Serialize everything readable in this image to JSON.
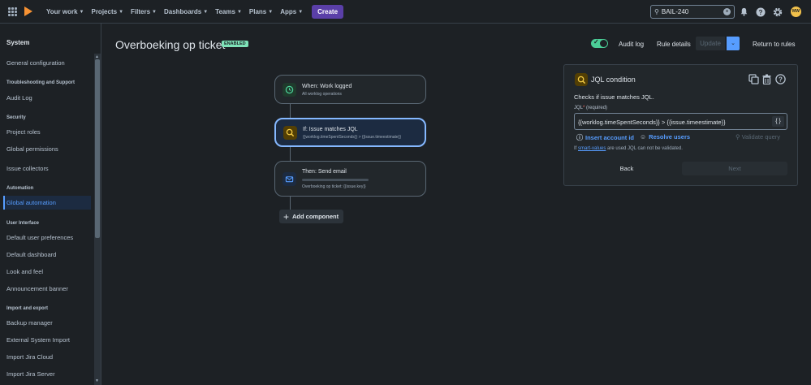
{
  "topnav": {
    "items": [
      "Your work",
      "Projects",
      "Filters",
      "Dashboards",
      "Teams",
      "Plans",
      "Apps"
    ],
    "create_label": "Create",
    "search_value": "BAIL-240",
    "avatar_initials": "MW"
  },
  "sidebar": {
    "title": "System",
    "entries": [
      {
        "type": "link",
        "label": "General configuration"
      },
      {
        "type": "head",
        "label": "Troubleshooting and Support"
      },
      {
        "type": "link",
        "label": "Audit Log"
      },
      {
        "type": "head",
        "label": "Security"
      },
      {
        "type": "link",
        "label": "Project roles"
      },
      {
        "type": "link",
        "label": "Global permissions"
      },
      {
        "type": "link",
        "label": "Issue collectors"
      },
      {
        "type": "head",
        "label": "Automation"
      },
      {
        "type": "link",
        "label": "Global automation",
        "active": true
      },
      {
        "type": "head",
        "label": "User Interface"
      },
      {
        "type": "link",
        "label": "Default user preferences"
      },
      {
        "type": "link",
        "label": "Default dashboard"
      },
      {
        "type": "link",
        "label": "Look and feel"
      },
      {
        "type": "link",
        "label": "Announcement banner"
      },
      {
        "type": "head",
        "label": "Import and export"
      },
      {
        "type": "link",
        "label": "Backup manager"
      },
      {
        "type": "link",
        "label": "External System Import"
      },
      {
        "type": "link",
        "label": "Import Jira Cloud"
      },
      {
        "type": "link",
        "label": "Import Jira Server"
      }
    ]
  },
  "header": {
    "title": "Overboeking op ticket",
    "badge": "ENABLED",
    "audit_log": "Audit log",
    "rule_details": "Rule details",
    "update": "Update",
    "return": "Return to rules"
  },
  "flow": {
    "trigger_title": "When: Work logged",
    "trigger_sub": "All worklog operations",
    "condition_title": "If: Issue matches JQL",
    "condition_sub": "{{worklog.timeSpentSeconds}} > {{issue.timeestimate}}",
    "action_title": "Then: Send email",
    "action_sub": "Overboeking op ticket: {{issue.key}}",
    "add_component": "Add component"
  },
  "panel": {
    "title": "JQL condition",
    "desc": "Checks if issue matches JQL.",
    "field_label": "JQL",
    "required_mark": "*",
    "required_text": "(required)",
    "jql_value": "{{worklog.timeSpentSeconds}} > {{issue.timeestimate}}",
    "braces": "{ }",
    "insert_account": "Insert account id",
    "resolve_users": "Resolve users",
    "validate_query": "Validate query",
    "note_prefix": "If",
    "note_link": "smart-values",
    "note_suffix": "are used JQL can not be validated.",
    "back": "Back",
    "next": "Next"
  },
  "colors": {
    "accent": "#579dff",
    "create": "#5a3fa8",
    "enabled": "#7ee2b8",
    "toggle": "#4bce97"
  }
}
